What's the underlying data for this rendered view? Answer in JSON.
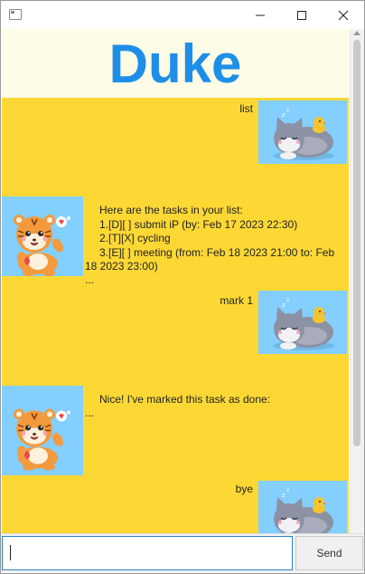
{
  "window": {
    "controls": {
      "minimize": "minimize-icon",
      "maximize": "maximize-icon",
      "close": "close-icon"
    }
  },
  "header": {
    "title": "Duke"
  },
  "messages": [
    {
      "sender": "user",
      "text": "list"
    },
    {
      "sender": "duke",
      "lines": [
        "Here are the tasks in your list:",
        "1.[D][ ] submit iP (by: Feb 17 2023 22:30)",
        "2.[T][X] cycling",
        "3.[E][ ] meeting (from: Feb 18 2023 21:00 to: Feb",
        "18 2023 23:00)",
        "..."
      ]
    },
    {
      "sender": "user",
      "text": "mark 1"
    },
    {
      "sender": "duke",
      "lines": [
        "Nice! I've marked this task as done:",
        "..."
      ]
    },
    {
      "sender": "user",
      "text": "bye"
    }
  ],
  "avatars": {
    "user": "sleeping-cat-avatar",
    "duke": "tiger-cub-avatar"
  },
  "input": {
    "value": "",
    "placeholder": ""
  },
  "send_button": {
    "label": "Send"
  },
  "colors": {
    "chat_background": "#fdd835",
    "header_background": "#fefbe6",
    "title_blue": "#1e8fe8",
    "avatar_background": "#83cfff"
  }
}
